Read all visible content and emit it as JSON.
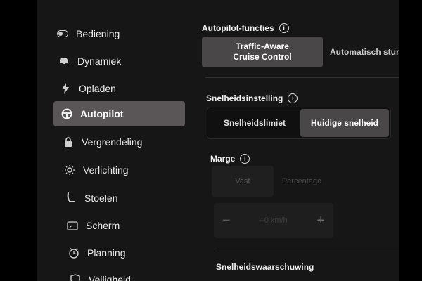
{
  "sidebar": {
    "items": [
      {
        "label": "Bediening",
        "icon": "toggle-icon"
      },
      {
        "label": "Dynamiek",
        "icon": "car-icon"
      },
      {
        "label": "Opladen",
        "icon": "lightning-icon"
      },
      {
        "label": "Autopilot",
        "icon": "steering-wheel-icon"
      },
      {
        "label": "Vergrendeling",
        "icon": "lock-icon"
      },
      {
        "label": "Verlichting",
        "icon": "sun-icon"
      },
      {
        "label": "Stoelen",
        "icon": "seat-icon"
      },
      {
        "label": "Scherm",
        "icon": "display-icon"
      },
      {
        "label": "Planning",
        "icon": "clock-icon"
      },
      {
        "label": "Veiligheid",
        "icon": "shield-icon"
      }
    ]
  },
  "autopilot_functions": {
    "title": "Autopilot-functies",
    "options": [
      "Traffic-Aware\nCruise Control",
      "Automatisch sturen"
    ]
  },
  "speed_setting": {
    "title": "Snelheidsinstelling",
    "options": [
      "Snelheidslimiet",
      "Huidige snelheid"
    ]
  },
  "margin": {
    "title": "Marge",
    "options": [
      "Vast",
      "Percentage"
    ],
    "stepper_value": "+0 km/h",
    "minus": "−",
    "plus": "+"
  },
  "speed_warning": {
    "title": "Snelheidswaarschuwing"
  },
  "colors": {
    "accent_active": "#5a5657",
    "selected_segment": "#4a4748"
  }
}
